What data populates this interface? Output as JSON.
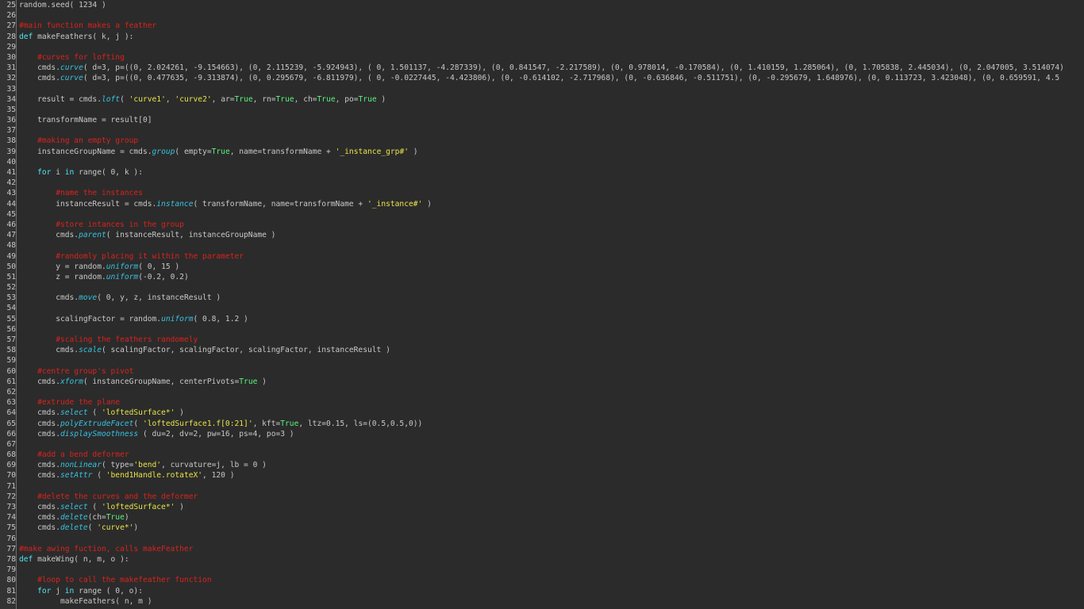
{
  "colors": {
    "background": "#2b2b2b",
    "gutter": "#333333",
    "plain": "#c8c8c8",
    "comment": "#d8231e",
    "keyword": "#53e3f0",
    "function": "#36c2e0",
    "string": "#e8e34a",
    "constant": "#5bf27a"
  },
  "lines": [
    {
      "n": "25",
      "tokens": [
        {
          "t": "random.seed( 1234 )",
          "c": "plain"
        }
      ]
    },
    {
      "n": "26",
      "tokens": []
    },
    {
      "n": "27",
      "tokens": [
        {
          "t": "#main function makes a feather",
          "c": "comment"
        }
      ]
    },
    {
      "n": "28",
      "tokens": [
        {
          "t": "def",
          "c": "keyword"
        },
        {
          "t": " makeFeathers( k, j ):",
          "c": "plain"
        }
      ]
    },
    {
      "n": "29",
      "tokens": []
    },
    {
      "n": "30",
      "tokens": [
        {
          "t": "    #curves for lofting",
          "c": "comment"
        }
      ]
    },
    {
      "n": "31",
      "tokens": [
        {
          "t": "    cmds.",
          "c": "plain"
        },
        {
          "t": "curve",
          "c": "func"
        },
        {
          "t": "( d=3, p=((0, 2.024261, -9.154663), (0, 2.115239, -5.924943), ( 0, 1.501137, -4.287339), (0, 0.841547, -2.217589), (0, 0.978014, -0.170584), (0, 1.410159, 1.285064), (0, 1.705838, 2.445034), (0, 2.047005, 3.514074)",
          "c": "plain"
        }
      ]
    },
    {
      "n": "32",
      "tokens": [
        {
          "t": "    cmds.",
          "c": "plain"
        },
        {
          "t": "curve",
          "c": "func"
        },
        {
          "t": "( d=3, p=((0, 0.477635, -9.313874), (0, 0.295679, -6.811979), ( 0, -0.0227445, -4.423806), (0, -0.614102, -2.717968), (0, -0.636846, -0.511751), (0, -0.295679, 1.648976), (0, 0.113723, 3.423048), (0, 0.659591, 4.5",
          "c": "plain"
        }
      ]
    },
    {
      "n": "33",
      "tokens": []
    },
    {
      "n": "34",
      "tokens": [
        {
          "t": "    result = cmds.",
          "c": "plain"
        },
        {
          "t": "loft",
          "c": "func"
        },
        {
          "t": "( ",
          "c": "plain"
        },
        {
          "t": "'curve1'",
          "c": "string"
        },
        {
          "t": ", ",
          "c": "plain"
        },
        {
          "t": "'curve2'",
          "c": "string"
        },
        {
          "t": ", ar=",
          "c": "plain"
        },
        {
          "t": "True",
          "c": "const"
        },
        {
          "t": ", rn=",
          "c": "plain"
        },
        {
          "t": "True",
          "c": "const"
        },
        {
          "t": ", ch=",
          "c": "plain"
        },
        {
          "t": "True",
          "c": "const"
        },
        {
          "t": ", po=",
          "c": "plain"
        },
        {
          "t": "True",
          "c": "const"
        },
        {
          "t": " )",
          "c": "plain"
        }
      ]
    },
    {
      "n": "35",
      "tokens": []
    },
    {
      "n": "36",
      "tokens": [
        {
          "t": "    transformName = result[0]",
          "c": "plain"
        }
      ]
    },
    {
      "n": "37",
      "tokens": []
    },
    {
      "n": "38",
      "tokens": [
        {
          "t": "    #making an empty group",
          "c": "comment"
        }
      ]
    },
    {
      "n": "39",
      "tokens": [
        {
          "t": "    instanceGroupName = cmds.",
          "c": "plain"
        },
        {
          "t": "group",
          "c": "func"
        },
        {
          "t": "( empty=",
          "c": "plain"
        },
        {
          "t": "True",
          "c": "const"
        },
        {
          "t": ", name=transformName + ",
          "c": "plain"
        },
        {
          "t": "'_instance_grp#'",
          "c": "string"
        },
        {
          "t": " )",
          "c": "plain"
        }
      ]
    },
    {
      "n": "40",
      "tokens": []
    },
    {
      "n": "41",
      "tokens": [
        {
          "t": "    ",
          "c": "plain"
        },
        {
          "t": "for",
          "c": "keyword"
        },
        {
          "t": " i ",
          "c": "plain"
        },
        {
          "t": "in",
          "c": "keyword"
        },
        {
          "t": " range( 0, k ):",
          "c": "plain"
        }
      ]
    },
    {
      "n": "42",
      "tokens": []
    },
    {
      "n": "43",
      "tokens": [
        {
          "t": "        #name the instances",
          "c": "comment"
        }
      ]
    },
    {
      "n": "44",
      "tokens": [
        {
          "t": "        instanceResult = cmds.",
          "c": "plain"
        },
        {
          "t": "instance",
          "c": "func"
        },
        {
          "t": "( transformName, name=transformName + ",
          "c": "plain"
        },
        {
          "t": "'_instance#'",
          "c": "string"
        },
        {
          "t": " )",
          "c": "plain"
        }
      ]
    },
    {
      "n": "45",
      "tokens": []
    },
    {
      "n": "46",
      "tokens": [
        {
          "t": "        #store intances in the group",
          "c": "comment"
        }
      ]
    },
    {
      "n": "47",
      "tokens": [
        {
          "t": "        cmds.",
          "c": "plain"
        },
        {
          "t": "parent",
          "c": "func"
        },
        {
          "t": "( instanceResult, instanceGroupName )",
          "c": "plain"
        }
      ]
    },
    {
      "n": "48",
      "tokens": []
    },
    {
      "n": "49",
      "tokens": [
        {
          "t": "        #randomly placing it within the parameter",
          "c": "comment"
        }
      ]
    },
    {
      "n": "50",
      "tokens": [
        {
          "t": "        y = random.",
          "c": "plain"
        },
        {
          "t": "uniform",
          "c": "func"
        },
        {
          "t": "( 0, 15 )",
          "c": "plain"
        }
      ]
    },
    {
      "n": "51",
      "tokens": [
        {
          "t": "        z = random.",
          "c": "plain"
        },
        {
          "t": "uniform",
          "c": "func"
        },
        {
          "t": "(-0.2, 0.2)",
          "c": "plain"
        }
      ]
    },
    {
      "n": "52",
      "tokens": []
    },
    {
      "n": "53",
      "tokens": [
        {
          "t": "        cmds.",
          "c": "plain"
        },
        {
          "t": "move",
          "c": "func"
        },
        {
          "t": "( 0, y, z, instanceResult )",
          "c": "plain"
        }
      ]
    },
    {
      "n": "54",
      "tokens": []
    },
    {
      "n": "55",
      "tokens": [
        {
          "t": "        scalingFactor = random.",
          "c": "plain"
        },
        {
          "t": "uniform",
          "c": "func"
        },
        {
          "t": "( 0.8, 1.2 )",
          "c": "plain"
        }
      ]
    },
    {
      "n": "56",
      "tokens": []
    },
    {
      "n": "57",
      "tokens": [
        {
          "t": "        #scaling the feathers randomely",
          "c": "comment"
        }
      ]
    },
    {
      "n": "58",
      "tokens": [
        {
          "t": "        cmds.",
          "c": "plain"
        },
        {
          "t": "scale",
          "c": "func"
        },
        {
          "t": "( scalingFactor, scalingFactor, scalingFactor, instanceResult )",
          "c": "plain"
        }
      ]
    },
    {
      "n": "59",
      "tokens": []
    },
    {
      "n": "60",
      "tokens": [
        {
          "t": "    #centre group's pivot",
          "c": "comment"
        }
      ]
    },
    {
      "n": "61",
      "tokens": [
        {
          "t": "    cmds.",
          "c": "plain"
        },
        {
          "t": "xform",
          "c": "func"
        },
        {
          "t": "( instanceGroupName, centerPivots=",
          "c": "plain"
        },
        {
          "t": "True",
          "c": "const"
        },
        {
          "t": " )",
          "c": "plain"
        }
      ]
    },
    {
      "n": "62",
      "tokens": []
    },
    {
      "n": "63",
      "tokens": [
        {
          "t": "    #extrude the plane",
          "c": "comment"
        }
      ]
    },
    {
      "n": "64",
      "tokens": [
        {
          "t": "    cmds.",
          "c": "plain"
        },
        {
          "t": "select",
          "c": "func"
        },
        {
          "t": " ( ",
          "c": "plain"
        },
        {
          "t": "'loftedSurface*'",
          "c": "string"
        },
        {
          "t": " )",
          "c": "plain"
        }
      ]
    },
    {
      "n": "65",
      "tokens": [
        {
          "t": "    cmds.",
          "c": "plain"
        },
        {
          "t": "polyExtrudeFacet",
          "c": "func"
        },
        {
          "t": "( ",
          "c": "plain"
        },
        {
          "t": "'loftedSurface1.f[0:21]'",
          "c": "string"
        },
        {
          "t": ", kft=",
          "c": "plain"
        },
        {
          "t": "True",
          "c": "const"
        },
        {
          "t": ", ltz=0.15, ls=(0.5,0.5,0))",
          "c": "plain"
        }
      ]
    },
    {
      "n": "66",
      "tokens": [
        {
          "t": "    cmds.",
          "c": "plain"
        },
        {
          "t": "displaySmoothness",
          "c": "func"
        },
        {
          "t": " ( du=2, dv=2, pw=16, ps=4, po=3 )",
          "c": "plain"
        }
      ]
    },
    {
      "n": "67",
      "tokens": []
    },
    {
      "n": "68",
      "tokens": [
        {
          "t": "    #add a bend deformer",
          "c": "comment"
        }
      ]
    },
    {
      "n": "69",
      "tokens": [
        {
          "t": "    cmds.",
          "c": "plain"
        },
        {
          "t": "nonLinear",
          "c": "func"
        },
        {
          "t": "( type=",
          "c": "plain"
        },
        {
          "t": "'bend'",
          "c": "string"
        },
        {
          "t": ", curvature=j, lb = 0 )",
          "c": "plain"
        }
      ]
    },
    {
      "n": "70",
      "tokens": [
        {
          "t": "    cmds.",
          "c": "plain"
        },
        {
          "t": "setAttr",
          "c": "func"
        },
        {
          "t": " ( ",
          "c": "plain"
        },
        {
          "t": "'bend1Handle.rotateX'",
          "c": "string"
        },
        {
          "t": ", 120 )",
          "c": "plain"
        }
      ]
    },
    {
      "n": "71",
      "tokens": []
    },
    {
      "n": "72",
      "tokens": [
        {
          "t": "    #delete the curves and the deformer",
          "c": "comment"
        }
      ]
    },
    {
      "n": "73",
      "tokens": [
        {
          "t": "    cmds.",
          "c": "plain"
        },
        {
          "t": "select",
          "c": "func"
        },
        {
          "t": " ( ",
          "c": "plain"
        },
        {
          "t": "'loftedSurface*'",
          "c": "string"
        },
        {
          "t": " )",
          "c": "plain"
        }
      ]
    },
    {
      "n": "74",
      "tokens": [
        {
          "t": "    cmds.",
          "c": "plain"
        },
        {
          "t": "delete",
          "c": "func"
        },
        {
          "t": "(ch=",
          "c": "plain"
        },
        {
          "t": "True",
          "c": "const"
        },
        {
          "t": ")",
          "c": "plain"
        }
      ]
    },
    {
      "n": "75",
      "tokens": [
        {
          "t": "    cmds.",
          "c": "plain"
        },
        {
          "t": "delete",
          "c": "func"
        },
        {
          "t": "( ",
          "c": "plain"
        },
        {
          "t": "'curve*'",
          "c": "string"
        },
        {
          "t": ")",
          "c": "plain"
        }
      ]
    },
    {
      "n": "76",
      "tokens": []
    },
    {
      "n": "77",
      "tokens": [
        {
          "t": "#make awing fuction, calls makeFeather",
          "c": "comment"
        }
      ]
    },
    {
      "n": "78",
      "tokens": [
        {
          "t": "def",
          "c": "keyword"
        },
        {
          "t": " makeWing( n, m, o ):",
          "c": "plain"
        }
      ]
    },
    {
      "n": "79",
      "tokens": []
    },
    {
      "n": "80",
      "tokens": [
        {
          "t": "    #loop to call the makefeather function",
          "c": "comment"
        }
      ]
    },
    {
      "n": "81",
      "tokens": [
        {
          "t": "    ",
          "c": "plain"
        },
        {
          "t": "for",
          "c": "keyword"
        },
        {
          "t": " j ",
          "c": "plain"
        },
        {
          "t": "in",
          "c": "keyword"
        },
        {
          "t": " range ( 0, o):",
          "c": "plain"
        }
      ]
    },
    {
      "n": "82",
      "tokens": [
        {
          "t": "         makeFeathers( n, m )",
          "c": "plain"
        }
      ]
    }
  ]
}
